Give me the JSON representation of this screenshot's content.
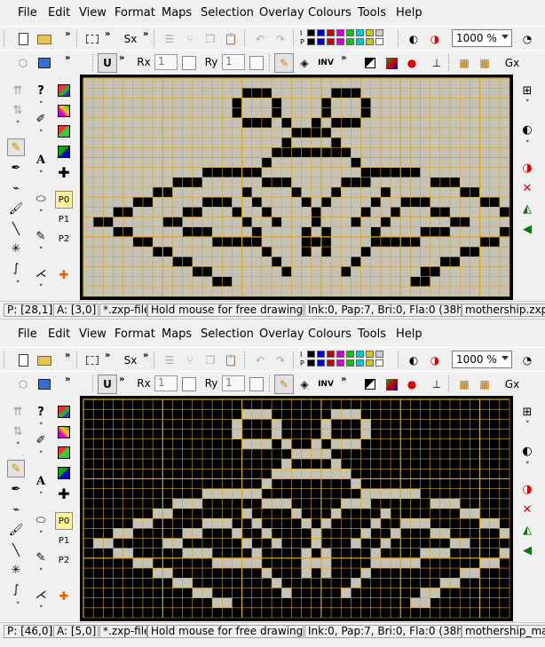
{
  "menu": [
    "File",
    "Edit",
    "View",
    "Format",
    "Maps",
    "Selection",
    "Overlay",
    "Colours",
    "Tools",
    "Help"
  ],
  "toolbar": {
    "sx_label": "Sx",
    "rx_label": "Rx",
    "ry_label": "Ry",
    "rx_value": "1",
    "ry_value": "1",
    "gx_label": "Gx",
    "zoom_value": "1000 %",
    "chevron": "»",
    "palette_labels": [
      "I",
      "P"
    ]
  },
  "palette_colors": [
    "#000000",
    "#0000cc",
    "#cc0000",
    "#cc00cc",
    "#00cc00",
    "#00cccc",
    "#cccc00",
    "#cccccc"
  ],
  "left_tools": {
    "help_label": "?",
    "text_label": "A",
    "p0": "P0",
    "p1": "P1",
    "p2": "P2"
  },
  "colors": {
    "grid_line": "#d4a62a",
    "paper_light": "#c6c3b6",
    "pixel_dark": "#000000"
  },
  "panes": [
    {
      "name": "normal-view",
      "inverted": false,
      "status": {
        "pos": "P: [28,1]",
        "attr": "A: [3,0]",
        "file": "*.zxp-file",
        "hint": "Hold mouse for free drawing...",
        "ink": "Ink:0, Pap:7, Bri:0, Fla:0 (38h)",
        "filename": "mothership.zxp"
      }
    },
    {
      "name": "inverted-view",
      "inverted": true,
      "status": {
        "pos": "P: [46,0]",
        "attr": "A: [5,0]",
        "file": "*.zxp-file",
        "hint": "Hold mouse for free drawing...",
        "ink": "Ink:0, Pap:7, Bri:0, Fla:0 (38h)",
        "filename": "mothership_mask.zxp"
      }
    }
  ],
  "sprite": {
    "cols": 43,
    "rows": 22,
    "pixels": [
      "0000000000000000000000000000000000000000000",
      "0000000000000000111000000111000000000000000",
      "0000000000000001000100001000100000000000000",
      "0000000000000001000100001000100000000000000",
      "0000000000000000111010010111000000000000000",
      "0000000000000000000001111000000000000000000",
      "0000000000000000000010000100000000000000000",
      "0000000000000000000111111110000000000000000",
      "0000000000000000001000000001000000000000000",
      "0000000000001111110000000000111111000000000",
      "0000000001110000001110000011100000011100000",
      "0000000110000000100001000100001000000011000",
      "0000011000001110010000101000010011100000110",
      "0001100000110001001000010000100100011000001",
      "0110000011000000100100010001001000000110000",
      "0001100000111000010000101000010000111000001",
      "0000011000000111110000111000011111000000110",
      "0000000110000000001000101000100000000011000",
      "0000000001100000000100000001000000001100000",
      "0000000000011000000010000010000000110000000",
      "0000000000000110000000000000000001100000000",
      "0000000000000000000000000000000000000000000"
    ]
  }
}
